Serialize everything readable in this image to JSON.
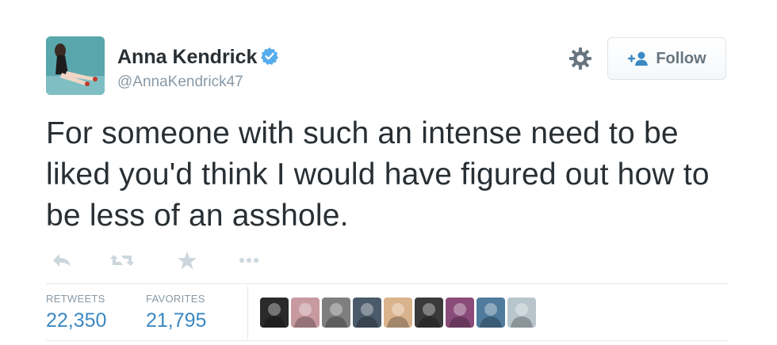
{
  "user": {
    "name": "Anna Kendrick",
    "handle": "@AnnaKendrick47",
    "verified": true
  },
  "follow_button": {
    "label": "Follow"
  },
  "tweet": {
    "text": "For someone with such an intense need to be liked you'd think I would have figured out how to be less of an asshole."
  },
  "stats": {
    "retweets": {
      "label": "RETWEETS",
      "value": "22,350"
    },
    "favorites": {
      "label": "FAVORITES",
      "value": "21,795"
    }
  },
  "icons": [
    "reply-icon",
    "retweet-icon",
    "favorite-icon",
    "more-icon",
    "gear-icon",
    "add-user-icon",
    "verified-badge-icon"
  ],
  "colors": {
    "link_blue": "#3b88c3",
    "muted_gray": "#8899a6",
    "text": "#292f33",
    "verified": "#55acee"
  },
  "favoriter_avatars": [
    "#2a2a2a",
    "#c79aa0",
    "#7e7e7e",
    "#4a5a6a",
    "#d9b38c",
    "#3a3a3a",
    "#8a4b7a",
    "#4f7b9c",
    "#b8c6cc"
  ]
}
